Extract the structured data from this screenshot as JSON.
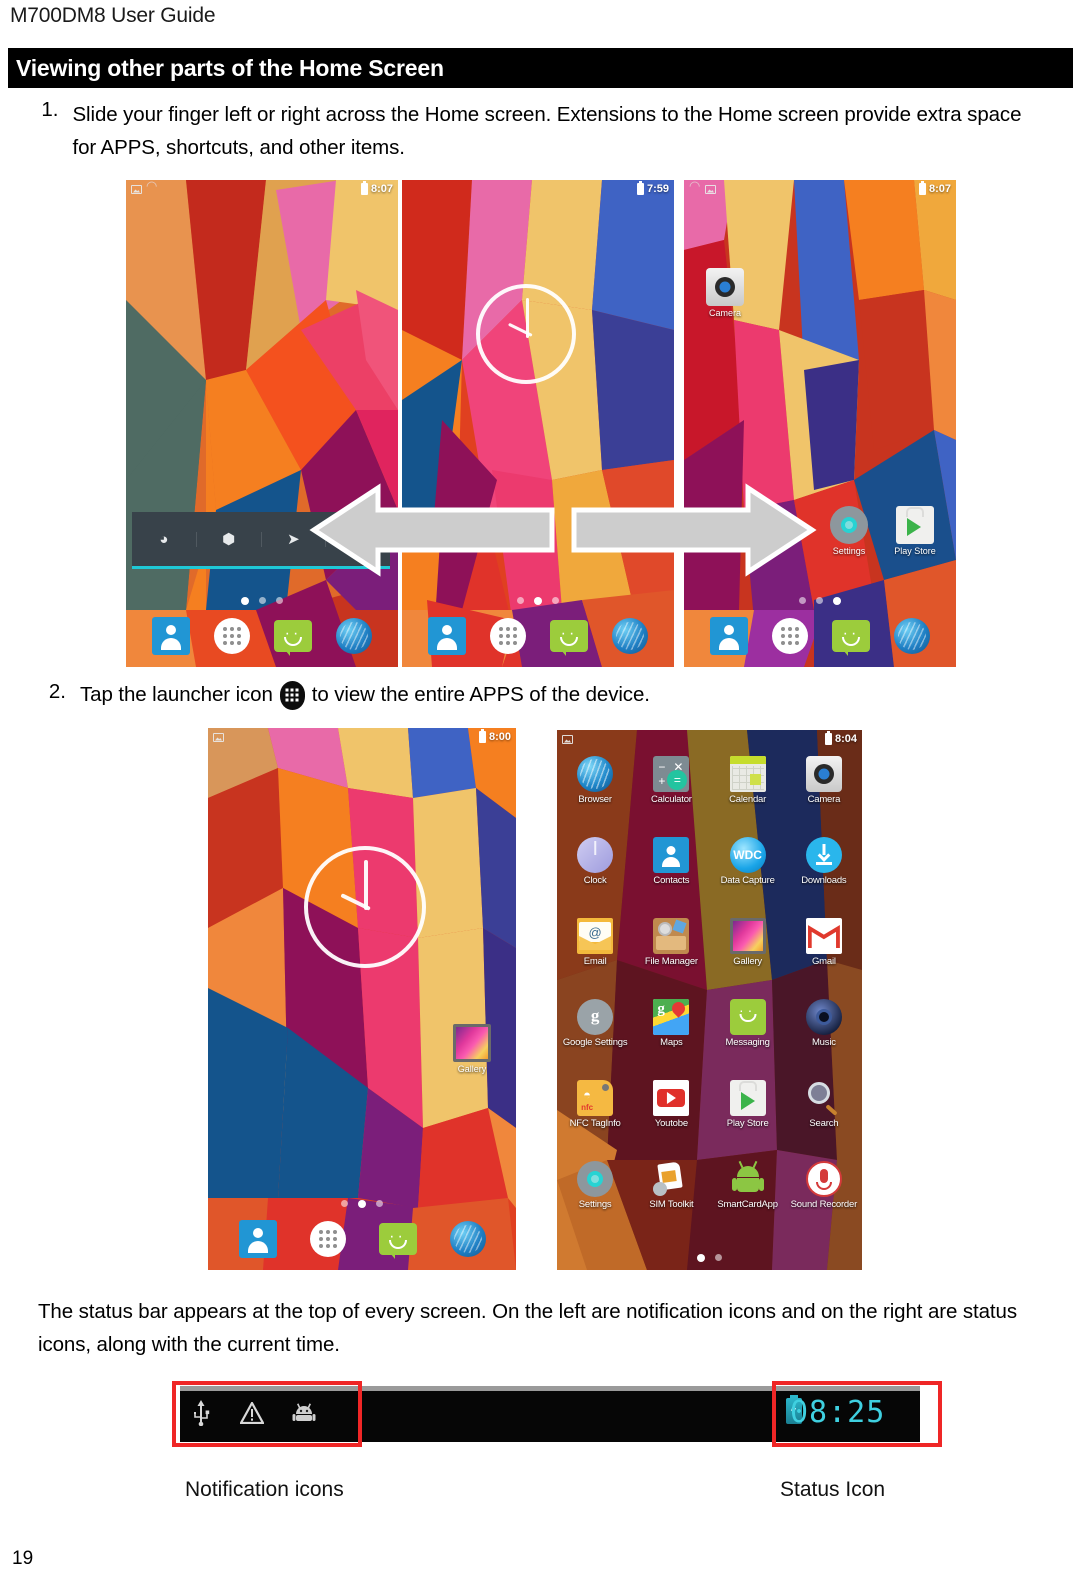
{
  "document": {
    "header": "M700DM8 User Guide",
    "section_title": "Viewing other parts of the Home Screen",
    "page_number": "19"
  },
  "steps": [
    {
      "number": "1.",
      "text": "Slide your finger left or right across the Home screen. Extensions to the Home screen provide extra space for APPS, shortcuts, and other items."
    },
    {
      "number": "2.",
      "text_before": "Tap the launcher icon",
      "icon": "launcher-grid-icon",
      "text_after": "to view the entire APPS of the device."
    }
  ],
  "paragraph": "The status bar appears at the top of every screen. On the left are notification icons and on the right are status icons, along with the current time.",
  "home_screens": [
    {
      "name": "home-screen-left",
      "status_time": "8:07",
      "status_icons": [
        "screenshot-icon",
        "wifi-icon"
      ],
      "page_dots": {
        "count": 3,
        "active": 0
      },
      "quick_settings": [
        "wifi-icon",
        "bluetooth-icon",
        "location-icon",
        "sync-icon"
      ],
      "dock": [
        "contacts-icon",
        "apps-launcher-icon",
        "messaging-icon",
        "browser-icon"
      ]
    },
    {
      "name": "home-screen-center",
      "status_time": "7:59",
      "status_icons": [],
      "page_dots": {
        "count": 3,
        "active": 1
      },
      "widget": "analog-clock-widget",
      "dock": [
        "contacts-icon",
        "apps-launcher-icon",
        "messaging-icon",
        "browser-icon"
      ]
    },
    {
      "name": "home-screen-right",
      "status_time": "8:07",
      "status_icons": [
        "wifi-icon",
        "screenshot-icon"
      ],
      "page_dots": {
        "count": 3,
        "active": 2
      },
      "icons": [
        {
          "label": "Camera",
          "glyph": "camera-icon"
        },
        {
          "label": "Settings",
          "glyph": "settings-icon"
        },
        {
          "label": "Play Store",
          "glyph": "play-store-icon"
        }
      ],
      "dock": [
        "contacts-icon",
        "apps-launcher-icon",
        "messaging-icon",
        "browser-icon"
      ]
    }
  ],
  "step2_screens": {
    "home": {
      "name": "home-screen-gallery",
      "status_time": "8:00",
      "status_icons": [
        "screenshot-icon"
      ],
      "page_dots": {
        "count": 3,
        "active": 1
      },
      "widget": "analog-clock-widget",
      "icons": [
        {
          "label": "Gallery",
          "glyph": "gallery-icon"
        }
      ],
      "dock": [
        "contacts-icon",
        "apps-launcher-icon",
        "messaging-icon",
        "browser-icon"
      ]
    },
    "app_drawer": {
      "name": "app-drawer-screen",
      "status_time": "8:04",
      "status_icons": [
        "screenshot-icon"
      ],
      "page_dots": {
        "count": 2,
        "active": 0
      },
      "apps": [
        {
          "label": "Browser",
          "glyph": "browser-icon"
        },
        {
          "label": "Calculator",
          "glyph": "calculator-icon"
        },
        {
          "label": "Calendar",
          "glyph": "calendar-icon"
        },
        {
          "label": "Camera",
          "glyph": "camera-icon"
        },
        {
          "label": "Clock",
          "glyph": "clock-icon"
        },
        {
          "label": "Contacts",
          "glyph": "contacts-icon"
        },
        {
          "label": "Data Capture",
          "glyph": "wdc-icon"
        },
        {
          "label": "Downloads",
          "glyph": "downloads-icon"
        },
        {
          "label": "Email",
          "glyph": "email-icon"
        },
        {
          "label": "File Manager",
          "glyph": "file-manager-icon"
        },
        {
          "label": "Gallery",
          "glyph": "gallery-icon"
        },
        {
          "label": "Gmail",
          "glyph": "gmail-icon"
        },
        {
          "label": "Google Settings",
          "glyph": "google-settings-icon"
        },
        {
          "label": "Maps",
          "glyph": "maps-icon"
        },
        {
          "label": "Messaging",
          "glyph": "messaging-icon"
        },
        {
          "label": "Music",
          "glyph": "music-icon"
        },
        {
          "label": "NFC TagInfo",
          "glyph": "nfc-taginfo-icon"
        },
        {
          "label": "Youtobe",
          "glyph": "youtube-icon"
        },
        {
          "label": "Play Store",
          "glyph": "play-store-icon"
        },
        {
          "label": "Search",
          "glyph": "search-icon"
        },
        {
          "label": "Settings",
          "glyph": "settings-icon"
        },
        {
          "label": "SIM Toolkit",
          "glyph": "sim-toolkit-icon"
        },
        {
          "label": "SmartCardApp",
          "glyph": "android-icon"
        },
        {
          "label": "Sound Recorder",
          "glyph": "sound-recorder-icon"
        }
      ]
    }
  },
  "arrows": [
    {
      "name": "arrow-left",
      "direction": "left"
    },
    {
      "name": "arrow-right",
      "direction": "right"
    }
  ],
  "status_bar_figure": {
    "notification_icons": [
      "usb-icon",
      "warning-icon",
      "android-icon"
    ],
    "status_time": "08:25",
    "battery_icon": "battery-charging-icon",
    "label_left": "Notification icons",
    "label_right": "Status Icon",
    "highlight_color": "#ef2626",
    "time_color": "#3fd0e0"
  }
}
